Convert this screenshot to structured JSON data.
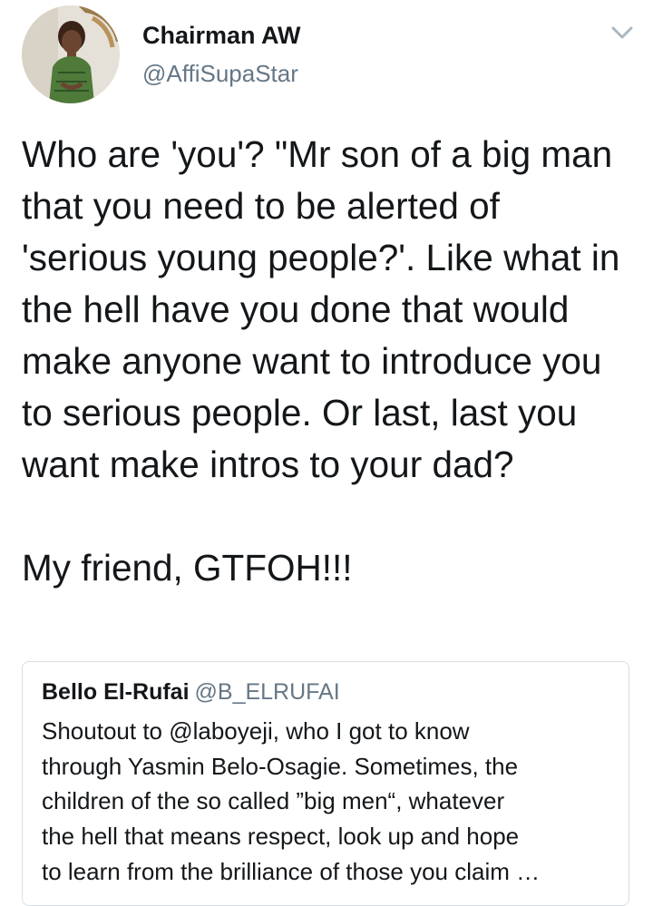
{
  "author": {
    "display_name": "Chairman AW",
    "handle": "@AffiSupaStar",
    "avatar_icon": "profile-photo"
  },
  "menu_icon": "chevron-down-icon",
  "tweet": {
    "text": "Who are 'you'? \"Mr son of a big man that you need to be alerted of 'serious young people?'. Like what in the hell have you done that would make anyone want to introduce you to serious people. Or last, last you want make intros to your dad?\n\nMy friend, GTFOH!!!"
  },
  "quoted_tweet": {
    "display_name": "Bello El-Rufai",
    "handle": "@B_ELRUFAI",
    "lines": [
      "Shoutout to @laboyeji, who I got to know",
      "through Yasmin Belo-Osagie. Sometimes, the",
      "children of the so called ”big men“, whatever",
      "the hell that means respect, look up and hope",
      "to learn from the brilliance of those you claim …"
    ]
  },
  "colors": {
    "primary_text": "#14171a",
    "secondary_text": "#657786",
    "border": "#d8dee2",
    "chevron": "#aab8c2"
  }
}
